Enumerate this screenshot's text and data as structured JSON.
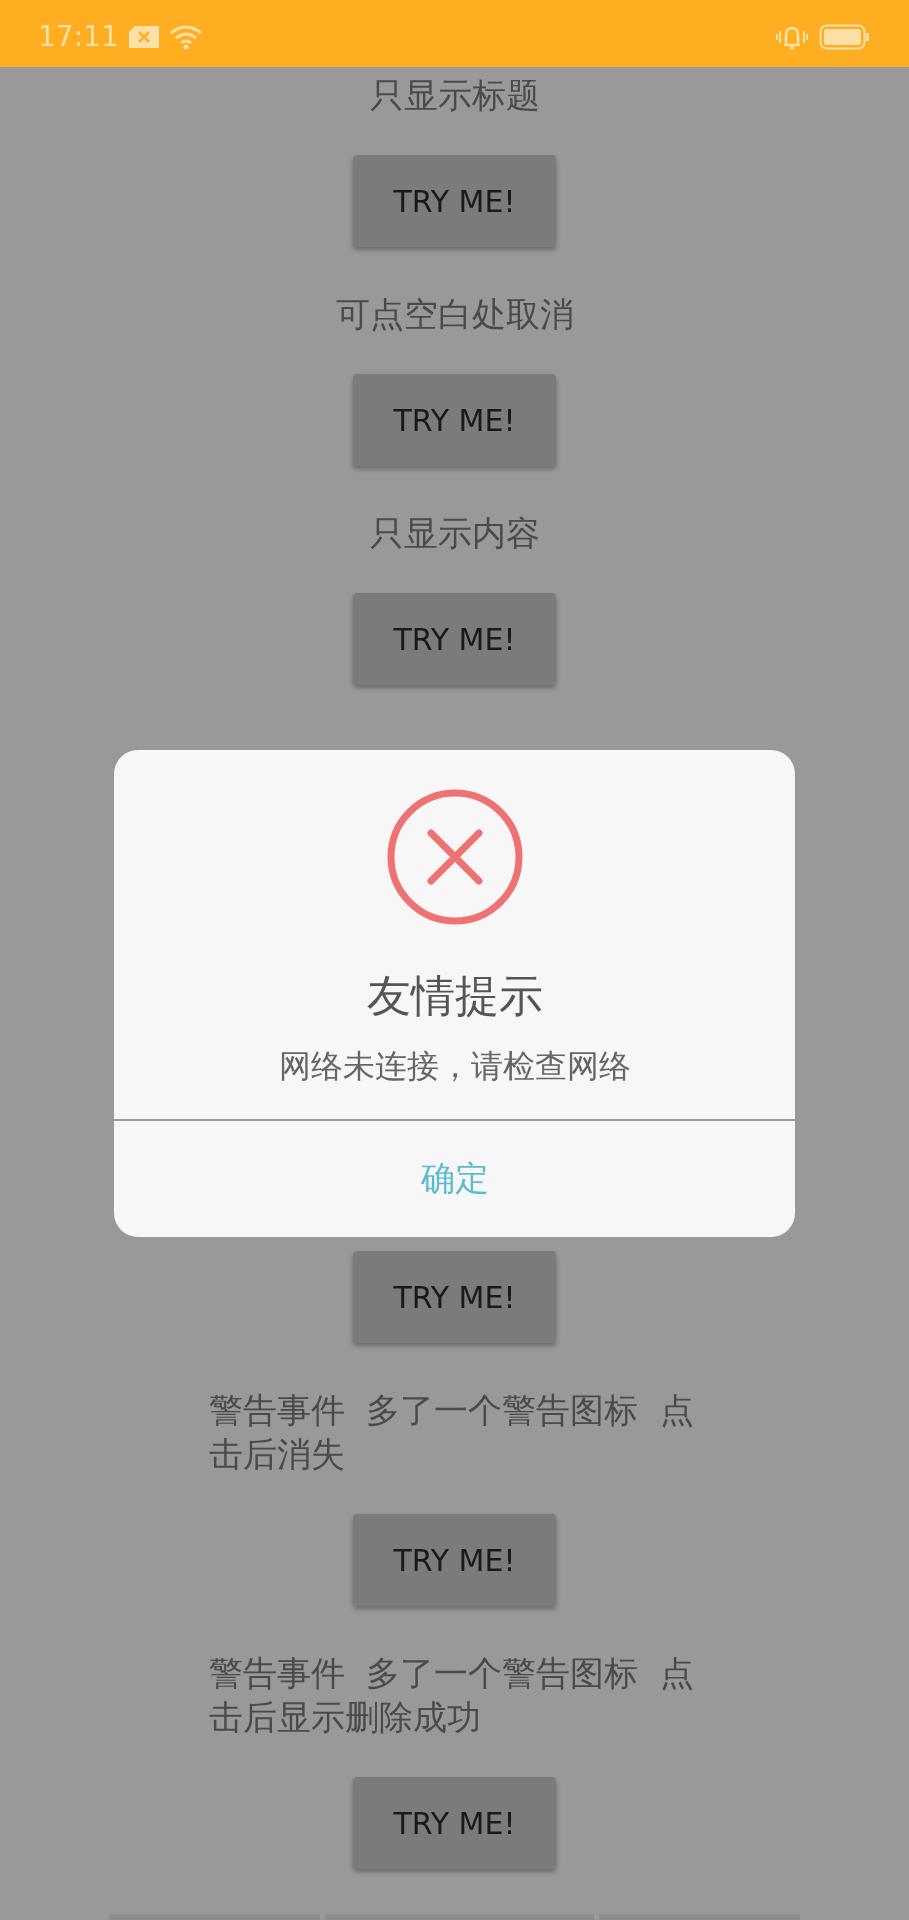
{
  "status_bar": {
    "time": "17:11"
  },
  "items": [
    {
      "label": "只显示标题",
      "button": "TRY ME!"
    },
    {
      "label": "可点空白处取消",
      "button": "TRY ME!"
    },
    {
      "label": "只显示内容",
      "button": "TRY ME!"
    },
    {
      "button": "TRY ME!"
    },
    {
      "label": "警告事件  多了一个警告图标  点击后消失",
      "button": "TRY ME!"
    },
    {
      "label": "警告事件  多了一个警告图标  点击后显示删除成功",
      "button": "TRY ME!"
    }
  ],
  "dialog": {
    "kind": "error",
    "title": "友情提示",
    "message": "网络未连接，请检查网络",
    "confirm": "确定"
  }
}
